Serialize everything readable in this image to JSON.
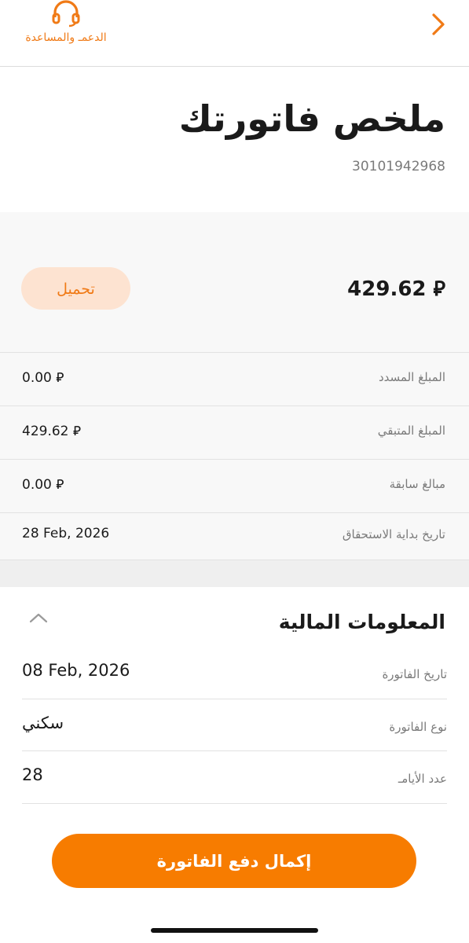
{
  "header": {
    "support_label": "الدعمـ والمساعدة"
  },
  "page": {
    "title": "ملخص فاتورتك",
    "invoice_number": "30101942968"
  },
  "summary": {
    "total_amount": "429.62 ⃁",
    "download_label": "تحميل",
    "rows": [
      {
        "label": "المبلغ المسدد",
        "value": "0.00 ⃁"
      },
      {
        "label": "المبلغ المتبقي",
        "value": "429.62 ⃁"
      },
      {
        "label": "مبالغ سابقة",
        "value": "0.00 ⃁"
      },
      {
        "label": "تاريخ بداية الاستحقاق",
        "value": "28 Feb, 2026"
      }
    ]
  },
  "financial": {
    "title": "المعلومات المالية",
    "rows": [
      {
        "label": "تاريخ الفاتورة",
        "value": "08 Feb, 2026"
      },
      {
        "label": "نوع الفاتورة",
        "value": "سكني"
      },
      {
        "label": "عدد الأيامـ",
        "value": "28"
      }
    ]
  },
  "actions": {
    "pay_label": "إكمال دفع الفاتورة"
  },
  "colors": {
    "accent": "#f77c00",
    "accent_light": "#fde3d1"
  },
  "icons": [
    "headset-icon",
    "chevron-right-icon",
    "chevron-up-icon"
  ]
}
